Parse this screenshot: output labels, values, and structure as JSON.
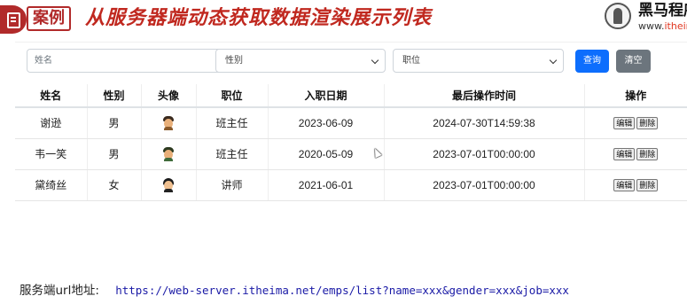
{
  "header": {
    "case_tag": "案例",
    "title": "从服务器端动态获取数据渲染展示列表",
    "logo_cn": "黑马程序",
    "logo_en_prefix": "www.",
    "logo_en_brand": "itheima"
  },
  "search": {
    "name_placeholder": "姓名",
    "gender_selected": "性别",
    "job_selected": "职位",
    "query_label": "查询",
    "clear_label": "清空"
  },
  "table": {
    "columns": [
      "姓名",
      "性别",
      "头像",
      "职位",
      "入职日期",
      "最后操作时间",
      "操作"
    ],
    "rows": [
      {
        "name": "谢逊",
        "gender": "男",
        "job": "班主任",
        "entry_date": "2023-06-09",
        "update_time": "2024-07-30T14:59:38",
        "edit": "编辑",
        "delete": "删除"
      },
      {
        "name": "韦一笑",
        "gender": "男",
        "job": "班主任",
        "entry_date": "2020-05-09",
        "update_time": "2023-07-01T00:00:00",
        "edit": "编辑",
        "delete": "删除"
      },
      {
        "name": "黛绮丝",
        "gender": "女",
        "job": "讲师",
        "entry_date": "2021-06-01",
        "update_time": "2023-07-01T00:00:00",
        "edit": "编辑",
        "delete": "删除"
      }
    ]
  },
  "footer": {
    "label": "服务端url地址:",
    "url": "https://web-server.itheima.net/emps/list?name=xxx&gender=xxx&job=xxx"
  },
  "colors": {
    "title_red": "#c0281f",
    "primary_button": "#0d6efd",
    "secondary_button": "#6c757d",
    "url_text": "#1a1aa6"
  }
}
